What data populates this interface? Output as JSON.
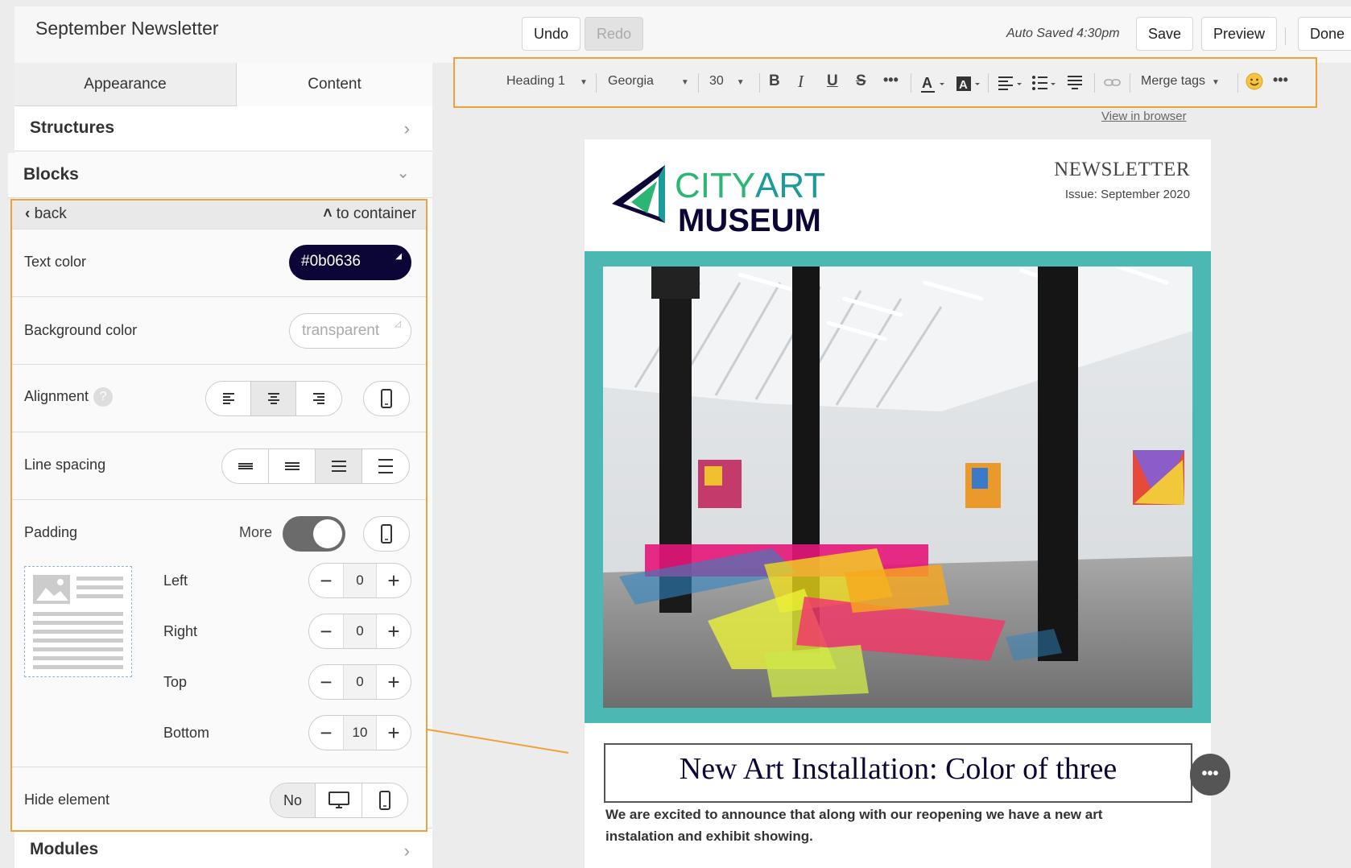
{
  "app": {
    "doc_title": "September Newsletter",
    "undo_label": "Undo",
    "redo_label": "Redo",
    "autosave_text": "Auto Saved 4:30pm",
    "save_label": "Save",
    "preview_label": "Preview",
    "done_label": "Done"
  },
  "sidebar": {
    "tabs": [
      {
        "label": "Appearance",
        "active": false
      },
      {
        "label": "Content",
        "active": true
      }
    ],
    "structures_label": "Structures",
    "blocks_label": "Blocks",
    "modules_label": "Modules"
  },
  "props": {
    "back_label": "back",
    "to_container_label": "to container",
    "text_color_label": "Text color",
    "text_color_value": "#0b0636",
    "bg_color_label": "Background color",
    "bg_color_value": "transparent",
    "alignment_label": "Alignment",
    "alignment_help": "?",
    "alignment_selected": "center",
    "line_spacing_label": "Line spacing",
    "line_spacing_selected": 3,
    "padding_label": "Padding",
    "more_label": "More",
    "more_on": true,
    "padding": [
      {
        "label": "Left",
        "value": "0"
      },
      {
        "label": "Right",
        "value": "0"
      },
      {
        "label": "Top",
        "value": "0"
      },
      {
        "label": "Bottom",
        "value": "10"
      }
    ],
    "hide_label": "Hide element",
    "hide_value": "No"
  },
  "toolbar": {
    "style": "Heading 1",
    "font": "Georgia",
    "size": "30",
    "bold": "B",
    "italic": "I",
    "underline": "U",
    "strike": "S",
    "merge_tags": "Merge tags"
  },
  "email": {
    "view_in_browser": "View in browser",
    "logo_line1_a": "CITY",
    "logo_line1_b": "ART",
    "logo_line2": "MUSEUM",
    "newsletter_title": "NEWSLETTER",
    "issue": "Issue: September 2020",
    "headline": "New Art Installation: Color of three",
    "body": "We are excited to announce that along with our reopening we have a new art instalation and exhibit showing."
  },
  "colors": {
    "accent_highlight": "#f0a13c",
    "text_color_swatch": "#0b0636",
    "hero_frame": "#4bb8b3",
    "logo_green": "#2bb673",
    "logo_navy": "#0b0636"
  }
}
